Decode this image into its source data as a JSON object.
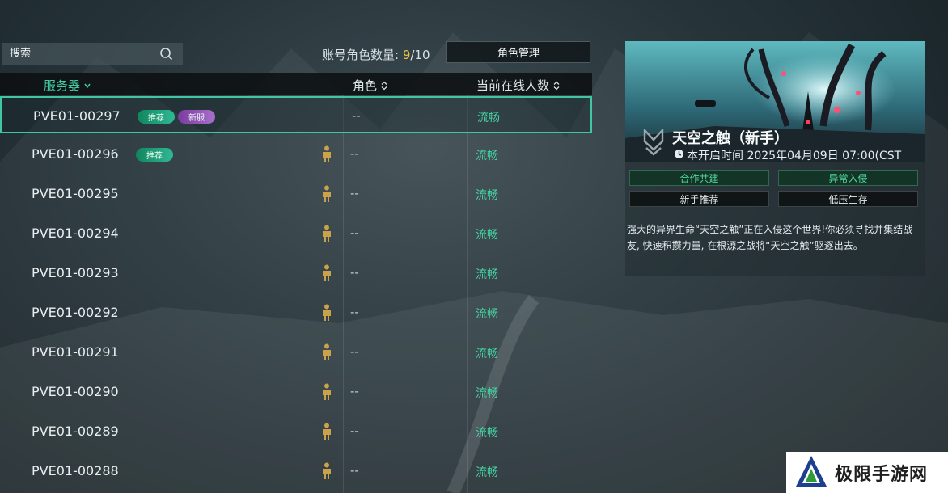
{
  "search": {
    "placeholder": "搜索",
    "icon": "search-icon"
  },
  "account": {
    "label": "账号角色数量: ",
    "current": "9",
    "separator": "/",
    "max": "10"
  },
  "manage_button": "角色管理",
  "table": {
    "headers": {
      "server": "服务器",
      "role": "角色",
      "online": "当前在线人数"
    },
    "rows": [
      {
        "name": "PVE01-00297",
        "tags": [
          "推荐",
          "新服"
        ],
        "role": "--",
        "status": "流畅",
        "selected": true,
        "has_role": false
      },
      {
        "name": "PVE01-00296",
        "tags": [
          "推荐"
        ],
        "role": "--",
        "status": "流畅",
        "selected": false,
        "has_role": true
      },
      {
        "name": "PVE01-00295",
        "tags": [],
        "role": "--",
        "status": "流畅",
        "selected": false,
        "has_role": true
      },
      {
        "name": "PVE01-00294",
        "tags": [],
        "role": "--",
        "status": "流畅",
        "selected": false,
        "has_role": true
      },
      {
        "name": "PVE01-00293",
        "tags": [],
        "role": "--",
        "status": "流畅",
        "selected": false,
        "has_role": true
      },
      {
        "name": "PVE01-00292",
        "tags": [],
        "role": "--",
        "status": "流畅",
        "selected": false,
        "has_role": true
      },
      {
        "name": "PVE01-00291",
        "tags": [],
        "role": "--",
        "status": "流畅",
        "selected": false,
        "has_role": true
      },
      {
        "name": "PVE01-00290",
        "tags": [],
        "role": "--",
        "status": "流畅",
        "selected": false,
        "has_role": true
      },
      {
        "name": "PVE01-00289",
        "tags": [],
        "role": "--",
        "status": "流畅",
        "selected": false,
        "has_role": true
      },
      {
        "name": "PVE01-00288",
        "tags": [],
        "role": "--",
        "status": "流畅",
        "selected": false,
        "has_role": true
      }
    ]
  },
  "panel": {
    "title": "天空之触（新手）",
    "time": "本开启时间 2025年04月09日 07:00(CST",
    "chips": [
      "合作共建",
      "异常入侵",
      "新手推荐",
      "低压生存"
    ],
    "description": "强大的异界生命“天空之触”正在入侵这个世界!你必须寻找并集结战友, 快速积攒力量, 在根源之战将“天空之触”驱逐出去。"
  },
  "watermark": {
    "text": "极限手游网"
  },
  "colors": {
    "accent": "#43c9a2",
    "status": "#45d4a4",
    "count": "#e7c341",
    "role_icon": "#c9a24a"
  }
}
